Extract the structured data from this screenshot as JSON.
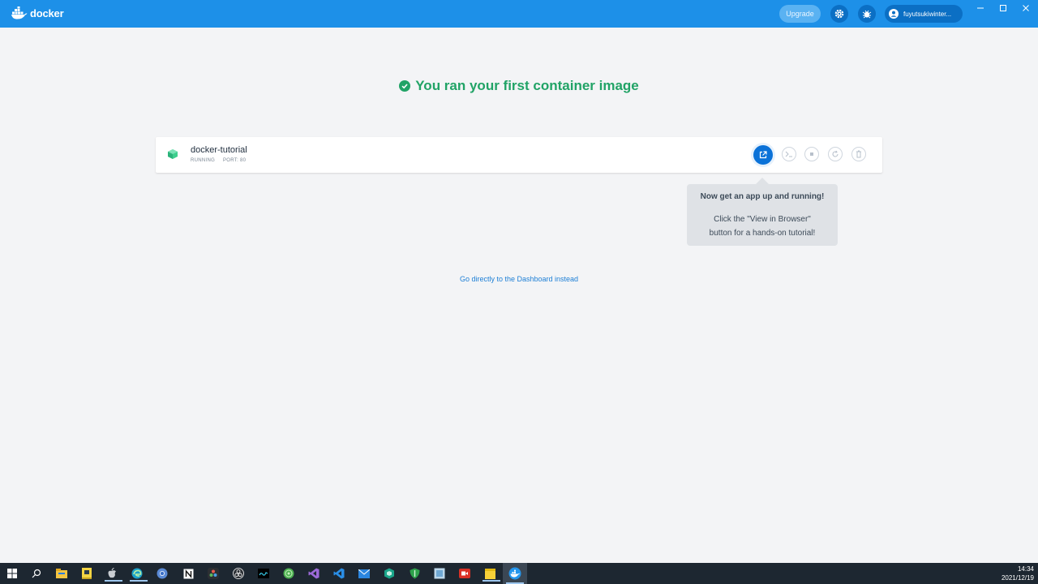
{
  "window": {
    "app_name": "docker",
    "upgrade_label": "Upgrade",
    "user_label": "fuyutsukiwinter...",
    "icons": [
      "docker-whale-icon",
      "gear-icon",
      "bug-icon",
      "account-icon"
    ],
    "brand_color": "#1d90e8"
  },
  "main": {
    "headline": "You ran your first container image",
    "success_color": "#21a366",
    "container": {
      "name": "docker-tutorial",
      "status": "RUNNING",
      "port": "PORT: 80",
      "actions": [
        "open-in-browser-icon",
        "cli-icon",
        "stop-icon",
        "restart-icon",
        "delete-icon"
      ]
    },
    "tooltip": {
      "title": "Now get an app up and running!",
      "line1": "Click the \"View in Browser\"",
      "line2": "button for a hands-on tutorial!"
    },
    "dashboard_link": "Go directly to the Dashboard instead"
  },
  "taskbar": {
    "time": "14:34",
    "date": "2021/12/19",
    "apps": [
      "start-icon",
      "search-icon",
      "file-explorer-icon",
      "notes-app-icon",
      "apple-icon",
      "edge-icon",
      "chrome-icon",
      "notion-icon",
      "davinci-icon",
      "obs-icon",
      "terminal-icon",
      "browser-icon",
      "visual-studio-icon",
      "vscode-icon",
      "mail-icon",
      "security-icon",
      "shield-icon",
      "viewer-icon",
      "video-app-icon",
      "sticky-notes-icon",
      "docker-icon"
    ]
  }
}
